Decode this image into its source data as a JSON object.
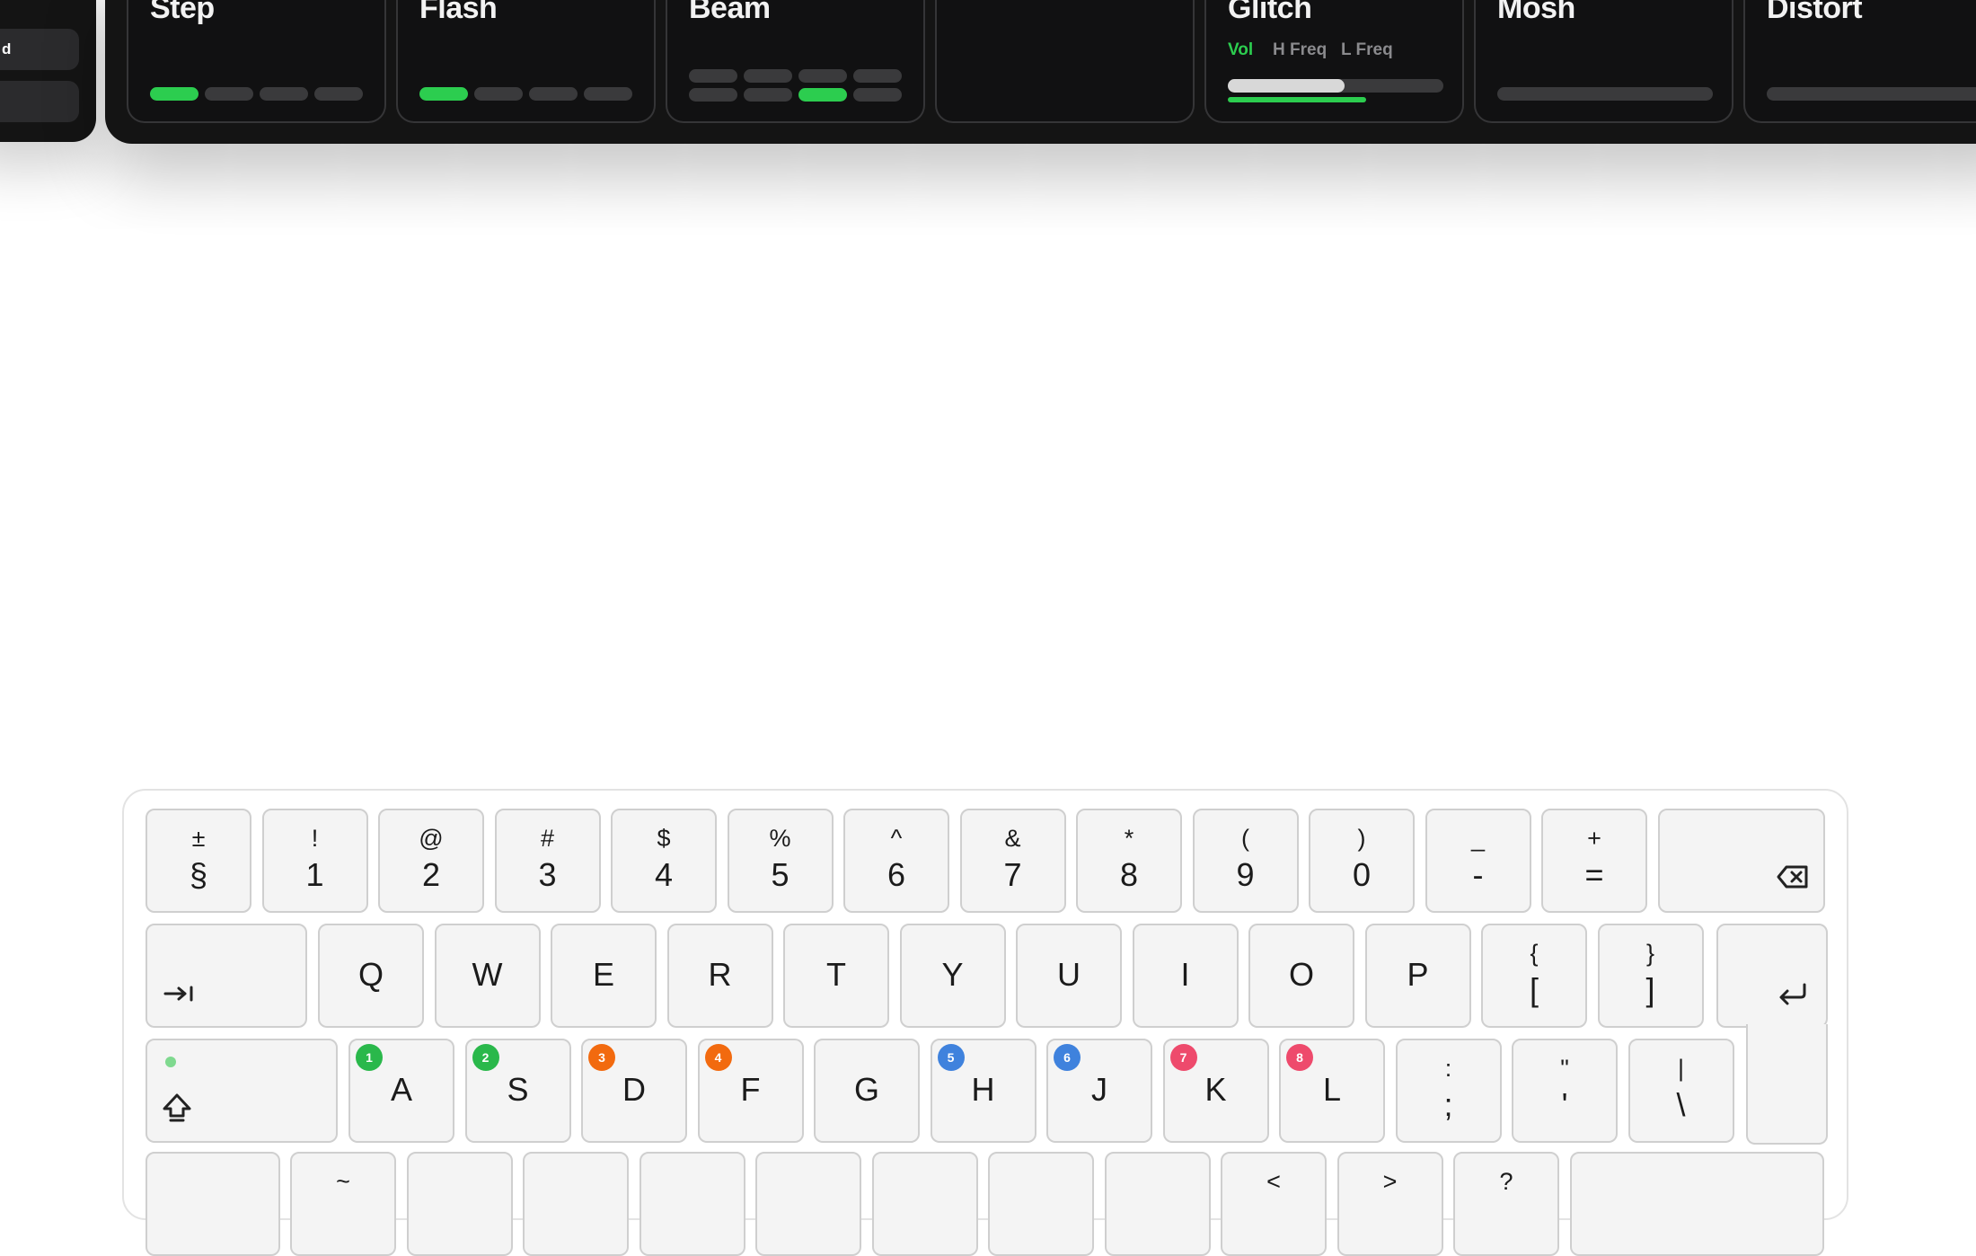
{
  "left_panel": {
    "buttons": [
      "",
      "d",
      ""
    ]
  },
  "cards": [
    {
      "title": "Step",
      "type": "steps4",
      "active_step": 0
    },
    {
      "title": "Flash",
      "type": "steps4",
      "active_step": 0
    },
    {
      "title": "Beam",
      "type": "grid8",
      "active_cell": 6
    },
    {
      "title": "",
      "type": "empty"
    },
    {
      "title": "Glitch",
      "type": "slider",
      "params": [
        "Vol",
        "H Freq",
        "L Freq"
      ],
      "active_param": 0,
      "level": 0.54,
      "sub_level": 0.64
    },
    {
      "title": "Mosh",
      "type": "track"
    },
    {
      "title": "Distort",
      "type": "track"
    }
  ],
  "colors": {
    "panel_bg": "#141414",
    "accent_green": "#2ccd4f",
    "key_bg": "#f4f4f4",
    "badge_green": "#2ab84b",
    "badge_orange": "#f26a0f",
    "badge_blue": "#3f82dd",
    "badge_pink": "#ee4a6c"
  },
  "keyboard": {
    "number_row": [
      {
        "sym": "±",
        "main": "§"
      },
      {
        "sym": "!",
        "main": "1"
      },
      {
        "sym": "@",
        "main": "2"
      },
      {
        "sym": "#",
        "main": "3"
      },
      {
        "sym": "$",
        "main": "4"
      },
      {
        "sym": "%",
        "main": "5"
      },
      {
        "sym": "^",
        "main": "6"
      },
      {
        "sym": "&",
        "main": "7"
      },
      {
        "sym": "*",
        "main": "8"
      },
      {
        "sym": "(",
        "main": "9"
      },
      {
        "sym": ")",
        "main": "0"
      },
      {
        "sym": "_",
        "main": "-"
      },
      {
        "sym": "+",
        "main": "="
      }
    ],
    "backspace_icon": "backspace-icon",
    "tab_icon": "tab-icon",
    "qwerty_row": [
      "Q",
      "W",
      "E",
      "R",
      "T",
      "Y",
      "U",
      "I",
      "O",
      "P"
    ],
    "bracket_keys": [
      {
        "sym": "{",
        "main": "["
      },
      {
        "sym": "}",
        "main": "]"
      }
    ],
    "return_icon": "return-icon",
    "caps_icon": "caps-lock-icon",
    "home_row": [
      {
        "letter": "A",
        "badge": "1",
        "color": "#2ab84b"
      },
      {
        "letter": "S",
        "badge": "2",
        "color": "#2ab84b"
      },
      {
        "letter": "D",
        "badge": "3",
        "color": "#f26a0f"
      },
      {
        "letter": "F",
        "badge": "4",
        "color": "#f26a0f"
      },
      {
        "letter": "G",
        "badge": "",
        "color": ""
      },
      {
        "letter": "H",
        "badge": "5",
        "color": "#3f82dd"
      },
      {
        "letter": "J",
        "badge": "6",
        "color": "#3f82dd"
      },
      {
        "letter": "K",
        "badge": "7",
        "color": "#ee4a6c"
      },
      {
        "letter": "L",
        "badge": "8",
        "color": "#ee4a6c"
      }
    ],
    "punct_keys": [
      {
        "sym": ":",
        "main": ";"
      },
      {
        "sym": "\"",
        "main": "'"
      },
      {
        "sym": "|",
        "main": "\\"
      }
    ],
    "bottom_row_partial": [
      "",
      "~",
      "",
      "",
      "",
      "",
      "",
      "",
      "",
      "<",
      ">",
      "?",
      ""
    ]
  }
}
